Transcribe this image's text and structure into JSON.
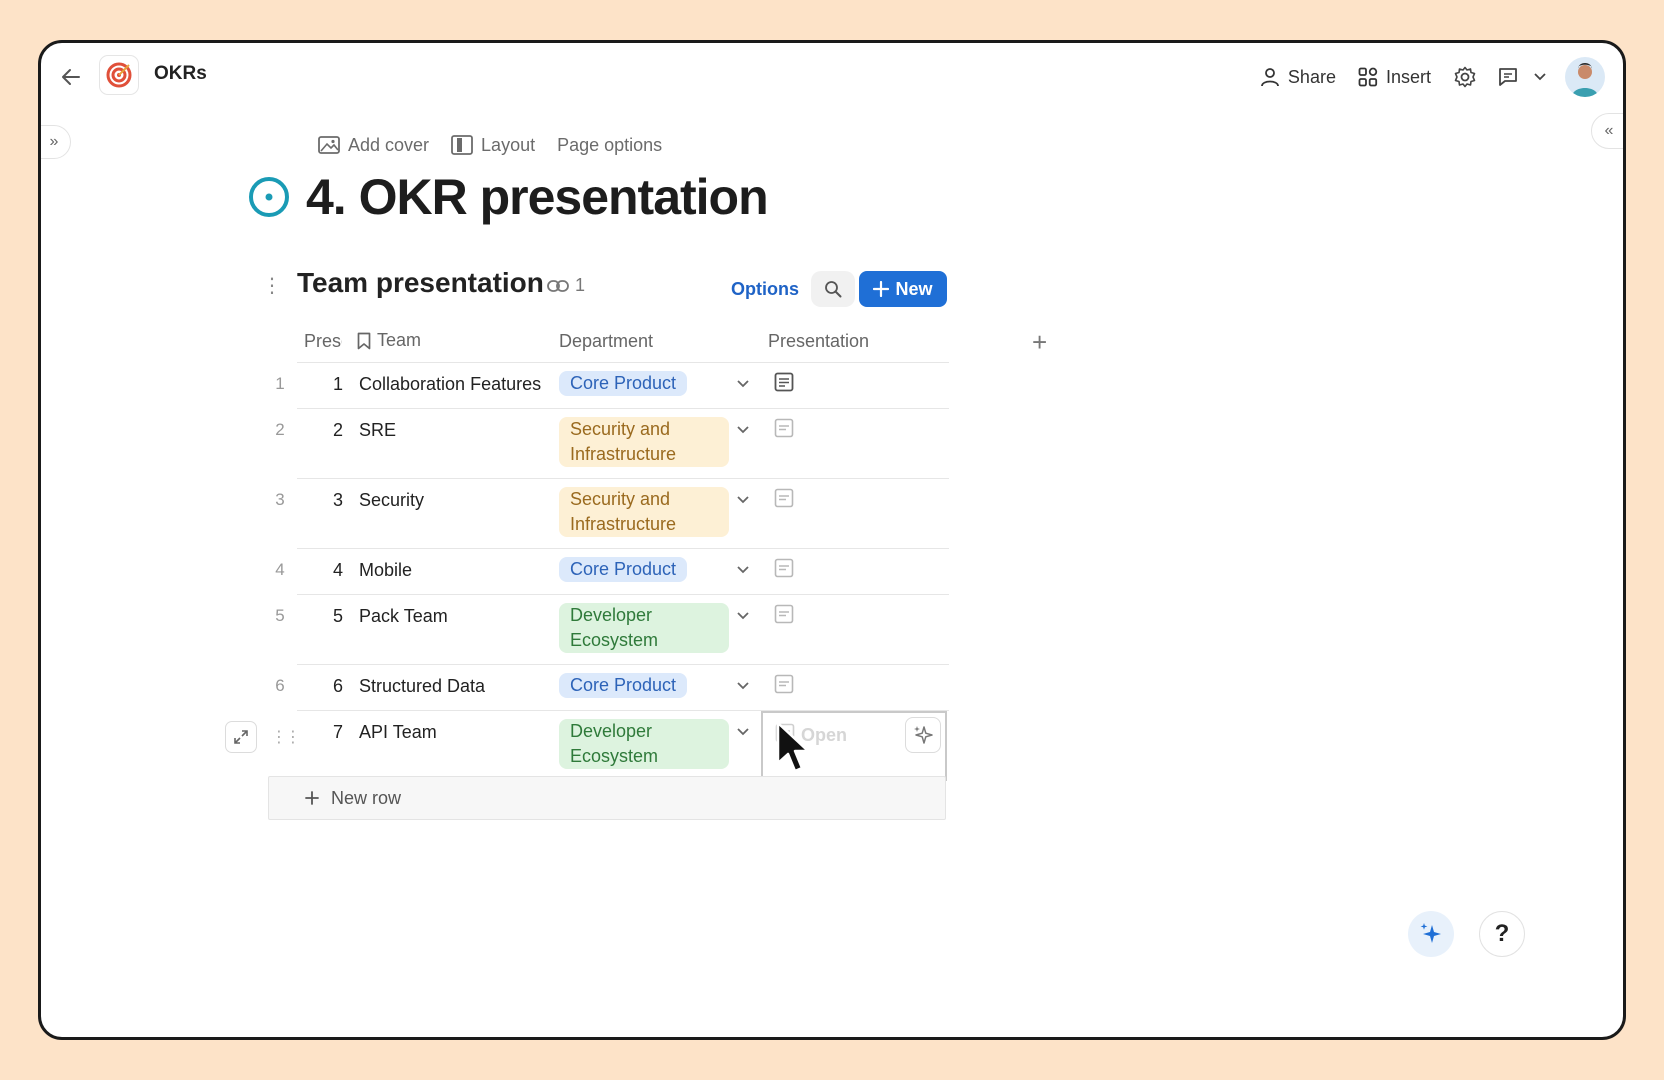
{
  "topbar": {
    "doc_title": "OKRs",
    "share_label": "Share",
    "insert_label": "Insert"
  },
  "page": {
    "add_cover": "Add cover",
    "layout": "Layout",
    "page_options": "Page options",
    "title": "4. OKR presentation"
  },
  "table": {
    "title": "Team presentation",
    "link_count": "1",
    "options_label": "Options",
    "new_label": "New",
    "columns": {
      "pres": "Presentation",
      "team": "Team",
      "department": "Department",
      "presentation": "Presentation"
    },
    "rows": [
      {
        "num": "1",
        "id": "1",
        "team": "Collaboration Features",
        "dept": "Core Product",
        "dept_color": "blue"
      },
      {
        "num": "2",
        "id": "2",
        "team": "SRE",
        "dept": "Security and Infrastructure",
        "dept_color": "yellow"
      },
      {
        "num": "3",
        "id": "3",
        "team": "Security",
        "dept": "Security and Infrastructure",
        "dept_color": "yellow"
      },
      {
        "num": "4",
        "id": "4",
        "team": "Mobile",
        "dept": "Core Product",
        "dept_color": "blue"
      },
      {
        "num": "5",
        "id": "5",
        "team": "Pack Team",
        "dept": "Developer Ecosystem",
        "dept_color": "green"
      },
      {
        "num": "6",
        "id": "6",
        "team": "Structured Data",
        "dept": "Core Product",
        "dept_color": "blue"
      },
      {
        "num": "",
        "id": "7",
        "team": "API Team",
        "dept": "Developer Ecosystem",
        "dept_color": "green"
      }
    ],
    "open_label": "Open",
    "new_row_label": "New row"
  },
  "colors": {
    "accent": "#1f6fd6",
    "title_icon": "#1a9bb5",
    "background": "#fde3c8"
  }
}
